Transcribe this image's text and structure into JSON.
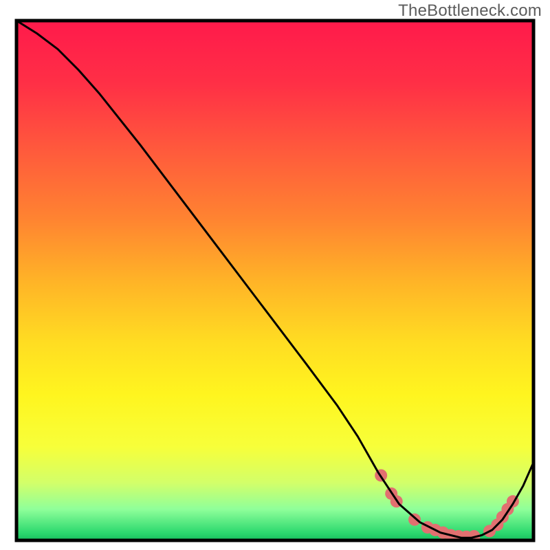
{
  "watermark": "TheBottleneck.com",
  "chart_data": {
    "type": "line",
    "title": "",
    "xlabel": "",
    "ylabel": "",
    "xlim": [
      0,
      100
    ],
    "ylim": [
      0,
      100
    ],
    "background": {
      "type": "vertical-gradient",
      "stops": [
        {
          "offset": 0.0,
          "color": "#ff1a4b"
        },
        {
          "offset": 0.12,
          "color": "#ff2f46"
        },
        {
          "offset": 0.25,
          "color": "#ff5a3c"
        },
        {
          "offset": 0.38,
          "color": "#ff8331"
        },
        {
          "offset": 0.5,
          "color": "#ffb327"
        },
        {
          "offset": 0.62,
          "color": "#ffdd22"
        },
        {
          "offset": 0.72,
          "color": "#fff51f"
        },
        {
          "offset": 0.82,
          "color": "#f7ff3a"
        },
        {
          "offset": 0.89,
          "color": "#d2ff6a"
        },
        {
          "offset": 0.94,
          "color": "#8fff9a"
        },
        {
          "offset": 0.985,
          "color": "#2dd96f"
        },
        {
          "offset": 1.0,
          "color": "#17c05f"
        }
      ]
    },
    "series": [
      {
        "name": "bottleneck-curve",
        "color": "#000000",
        "x": [
          0,
          4,
          8,
          12,
          16,
          24,
          32,
          40,
          48,
          56,
          62,
          66,
          70,
          72,
          74,
          78,
          82,
          86,
          88,
          90,
          92,
          94,
          96,
          98,
          100
        ],
        "y": [
          100,
          97.5,
          94.5,
          90.5,
          86,
          76,
          65.5,
          55,
          44.5,
          34,
          26,
          20,
          13,
          10,
          7,
          3.5,
          1.5,
          0.5,
          0.5,
          1,
          2,
          4,
          7,
          10.5,
          15
        ]
      }
    ],
    "markers": {
      "name": "highlight-dots",
      "color": "#e17070",
      "radius": 9,
      "points": [
        {
          "x": 70.5,
          "y": 12.5
        },
        {
          "x": 72.5,
          "y": 9.0
        },
        {
          "x": 73.5,
          "y": 7.5
        },
        {
          "x": 77.0,
          "y": 4.0
        },
        {
          "x": 79.5,
          "y": 2.5
        },
        {
          "x": 81.0,
          "y": 2.0
        },
        {
          "x": 82.5,
          "y": 1.5
        },
        {
          "x": 84.0,
          "y": 1.0
        },
        {
          "x": 85.5,
          "y": 0.8
        },
        {
          "x": 87.0,
          "y": 0.7
        },
        {
          "x": 88.5,
          "y": 0.8
        },
        {
          "x": 91.5,
          "y": 1.8
        },
        {
          "x": 93.0,
          "y": 3.0
        },
        {
          "x": 94.0,
          "y": 4.5
        },
        {
          "x": 95.0,
          "y": 6.0
        },
        {
          "x": 96.0,
          "y": 7.5
        }
      ]
    },
    "frame": {
      "stroke": "#000000",
      "width": 5
    }
  }
}
